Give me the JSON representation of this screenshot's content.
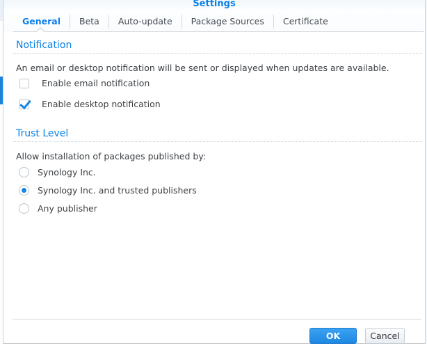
{
  "dialog": {
    "title": "Settings"
  },
  "tabs": [
    {
      "label": "General",
      "active": true
    },
    {
      "label": "Beta",
      "active": false
    },
    {
      "label": "Auto-update",
      "active": false
    },
    {
      "label": "Package Sources",
      "active": false
    },
    {
      "label": "Certificate",
      "active": false
    }
  ],
  "sections": {
    "notification": {
      "heading": "Notification",
      "description": "An email or desktop notification will be sent or displayed when updates are available.",
      "checkboxes": [
        {
          "label": "Enable email notification",
          "checked": false
        },
        {
          "label": "Enable desktop notification",
          "checked": true
        }
      ]
    },
    "trust_level": {
      "heading": "Trust Level",
      "description": "Allow installation of packages published by:",
      "radios": [
        {
          "label": "Synology Inc.",
          "selected": false
        },
        {
          "label": "Synology Inc. and trusted publishers",
          "selected": true
        },
        {
          "label": "Any publisher",
          "selected": false
        }
      ]
    }
  },
  "footer": {
    "ok_label": "OK",
    "cancel_label": "Cancel"
  },
  "colors": {
    "accent_blue": "#0c82e6",
    "ok_button_blue": "#1e88e2",
    "selected_control_blue": "#1286e8",
    "border_gray": "#ccd1d6"
  }
}
